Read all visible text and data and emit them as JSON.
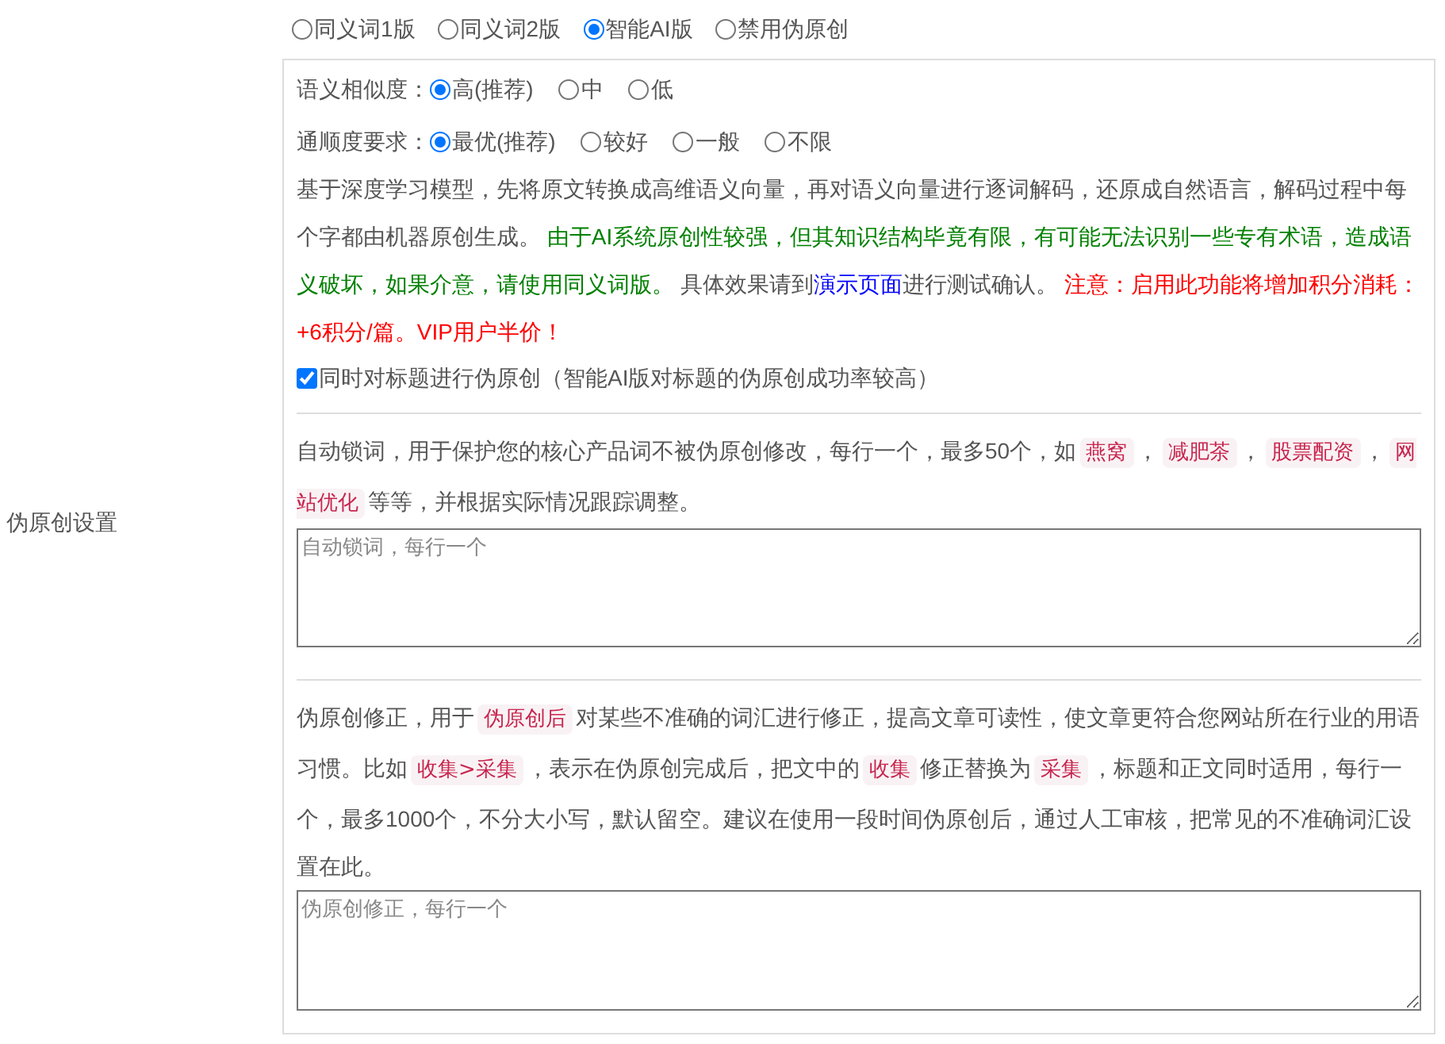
{
  "section_label": "伪原创设置",
  "modes": [
    {
      "label": "同义词1版",
      "selected": false
    },
    {
      "label": "同义词2版",
      "selected": false
    },
    {
      "label": "智能AI版",
      "selected": true
    },
    {
      "label": "禁用伪原创",
      "selected": false
    }
  ],
  "similarity": {
    "label": "语义相似度：",
    "options": [
      {
        "label": "高(推荐)",
        "selected": true
      },
      {
        "label": "中",
        "selected": false
      },
      {
        "label": "低",
        "selected": false
      }
    ]
  },
  "fluency": {
    "label": "通顺度要求：",
    "options": [
      {
        "label": "最优(推荐)",
        "selected": true
      },
      {
        "label": "较好",
        "selected": false
      },
      {
        "label": "一般",
        "selected": false
      },
      {
        "label": "不限",
        "selected": false
      }
    ]
  },
  "ai_description": [
    {
      "kind": "plain",
      "text": "基于深度学习模型，先将原文转换成高维语义向量，再对语义向量进行逐词解码，还原成自然语言，解码过程中每个字都由机器原创生成。 "
    },
    {
      "kind": "note",
      "text": "由于AI系统原创性较强，但其知识结构毕竟有限，有可能无法识别一些专有术语，造成语义破坏，如果介意，请使用同义词版。"
    },
    {
      "kind": "plain",
      "text": " 具体效果请到"
    },
    {
      "kind": "link",
      "text": "演示页面"
    },
    {
      "kind": "plain",
      "text": "进行测试确认。 "
    },
    {
      "kind": "warning",
      "text": "注意：启用此功能将增加积分消耗：+6积分/篇。VIP用户半价！"
    }
  ],
  "title_checkbox": {
    "label": "同时对标题进行伪原创（智能AI版对标题的伪原创成功率较高）",
    "checked": true
  },
  "lock_words": {
    "description": [
      {
        "kind": "plain",
        "text": "自动锁词，用于保护您的核心产品词不被伪原创修改，每行一个，最多50个，如"
      },
      {
        "kind": "code",
        "text": "燕窝"
      },
      {
        "kind": "plain",
        "text": "，"
      },
      {
        "kind": "code",
        "text": "减肥茶"
      },
      {
        "kind": "plain",
        "text": "，"
      },
      {
        "kind": "code",
        "text": "股票配资"
      },
      {
        "kind": "plain",
        "text": "，"
      },
      {
        "kind": "code",
        "text": "网站优化"
      },
      {
        "kind": "plain",
        "text": "等等，并根据实际情况跟踪调整。"
      }
    ],
    "placeholder": "自动锁词，每行一个"
  },
  "corrections": {
    "description": [
      {
        "kind": "plain",
        "text": "伪原创修正，用于"
      },
      {
        "kind": "code",
        "text": "伪原创后"
      },
      {
        "kind": "plain",
        "text": "对某些不准确的词汇进行修正，提高文章可读性，使文章更符合您网站所在行业的用语习惯。比如"
      },
      {
        "kind": "code",
        "text": "收集>采集"
      },
      {
        "kind": "plain",
        "text": "，表示在伪原创完成后，把文中的"
      },
      {
        "kind": "code",
        "text": "收集"
      },
      {
        "kind": "plain",
        "text": "修正替换为"
      },
      {
        "kind": "code",
        "text": "采集"
      },
      {
        "kind": "plain",
        "text": "，标题和正文同时适用，每行一个，最多1000个，不分大小写，默认留空。建议在使用一段时间伪原创后，通过人工审核，把常见的不准确词汇设置在此。"
      }
    ],
    "placeholder": "伪原创修正，每行一个"
  }
}
